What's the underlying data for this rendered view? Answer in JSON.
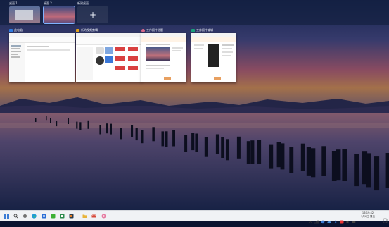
{
  "desktops": [
    {
      "label": "桌面 1",
      "current": false
    },
    {
      "label": "桌面 2",
      "current": true
    },
    {
      "label": "新建桌面",
      "icon": "plus-icon"
    }
  ],
  "windows": [
    {
      "title": "此电脑",
      "icon": "folder-icon",
      "accent": "#2f7be0"
    },
    {
      "title": "新的视频剪辑",
      "icon": "video-app-icon",
      "accent": "#e0a01a"
    },
    {
      "title": "工作照片选题",
      "icon": "photos-icon",
      "accent": "#d86a8a"
    },
    {
      "title": "工作照片编辑",
      "icon": "image-editor-icon",
      "accent": "#1aa07a"
    }
  ],
  "taskbar": {
    "apps": [
      "windows-start-icon",
      "search-icon",
      "settings-icon",
      "edge-browser-icon",
      "paint-icon",
      "wechat-icon",
      "image-viewer-icon",
      "office-icon",
      "file-explorer-icon",
      "mail-icon",
      "photos-app-icon"
    ],
    "tray_icons": [
      "chevron-up-icon",
      "network-icon",
      "volume-icon",
      "battery-icon",
      "cloud-icon",
      "bluetooth-icon",
      "security-icon",
      "input-method-icon"
    ],
    "time": "16:19:42",
    "date": "1月6日 周五"
  },
  "colors": {
    "accent": "#7fb2ff",
    "taskbar": "#f0f2f5"
  }
}
